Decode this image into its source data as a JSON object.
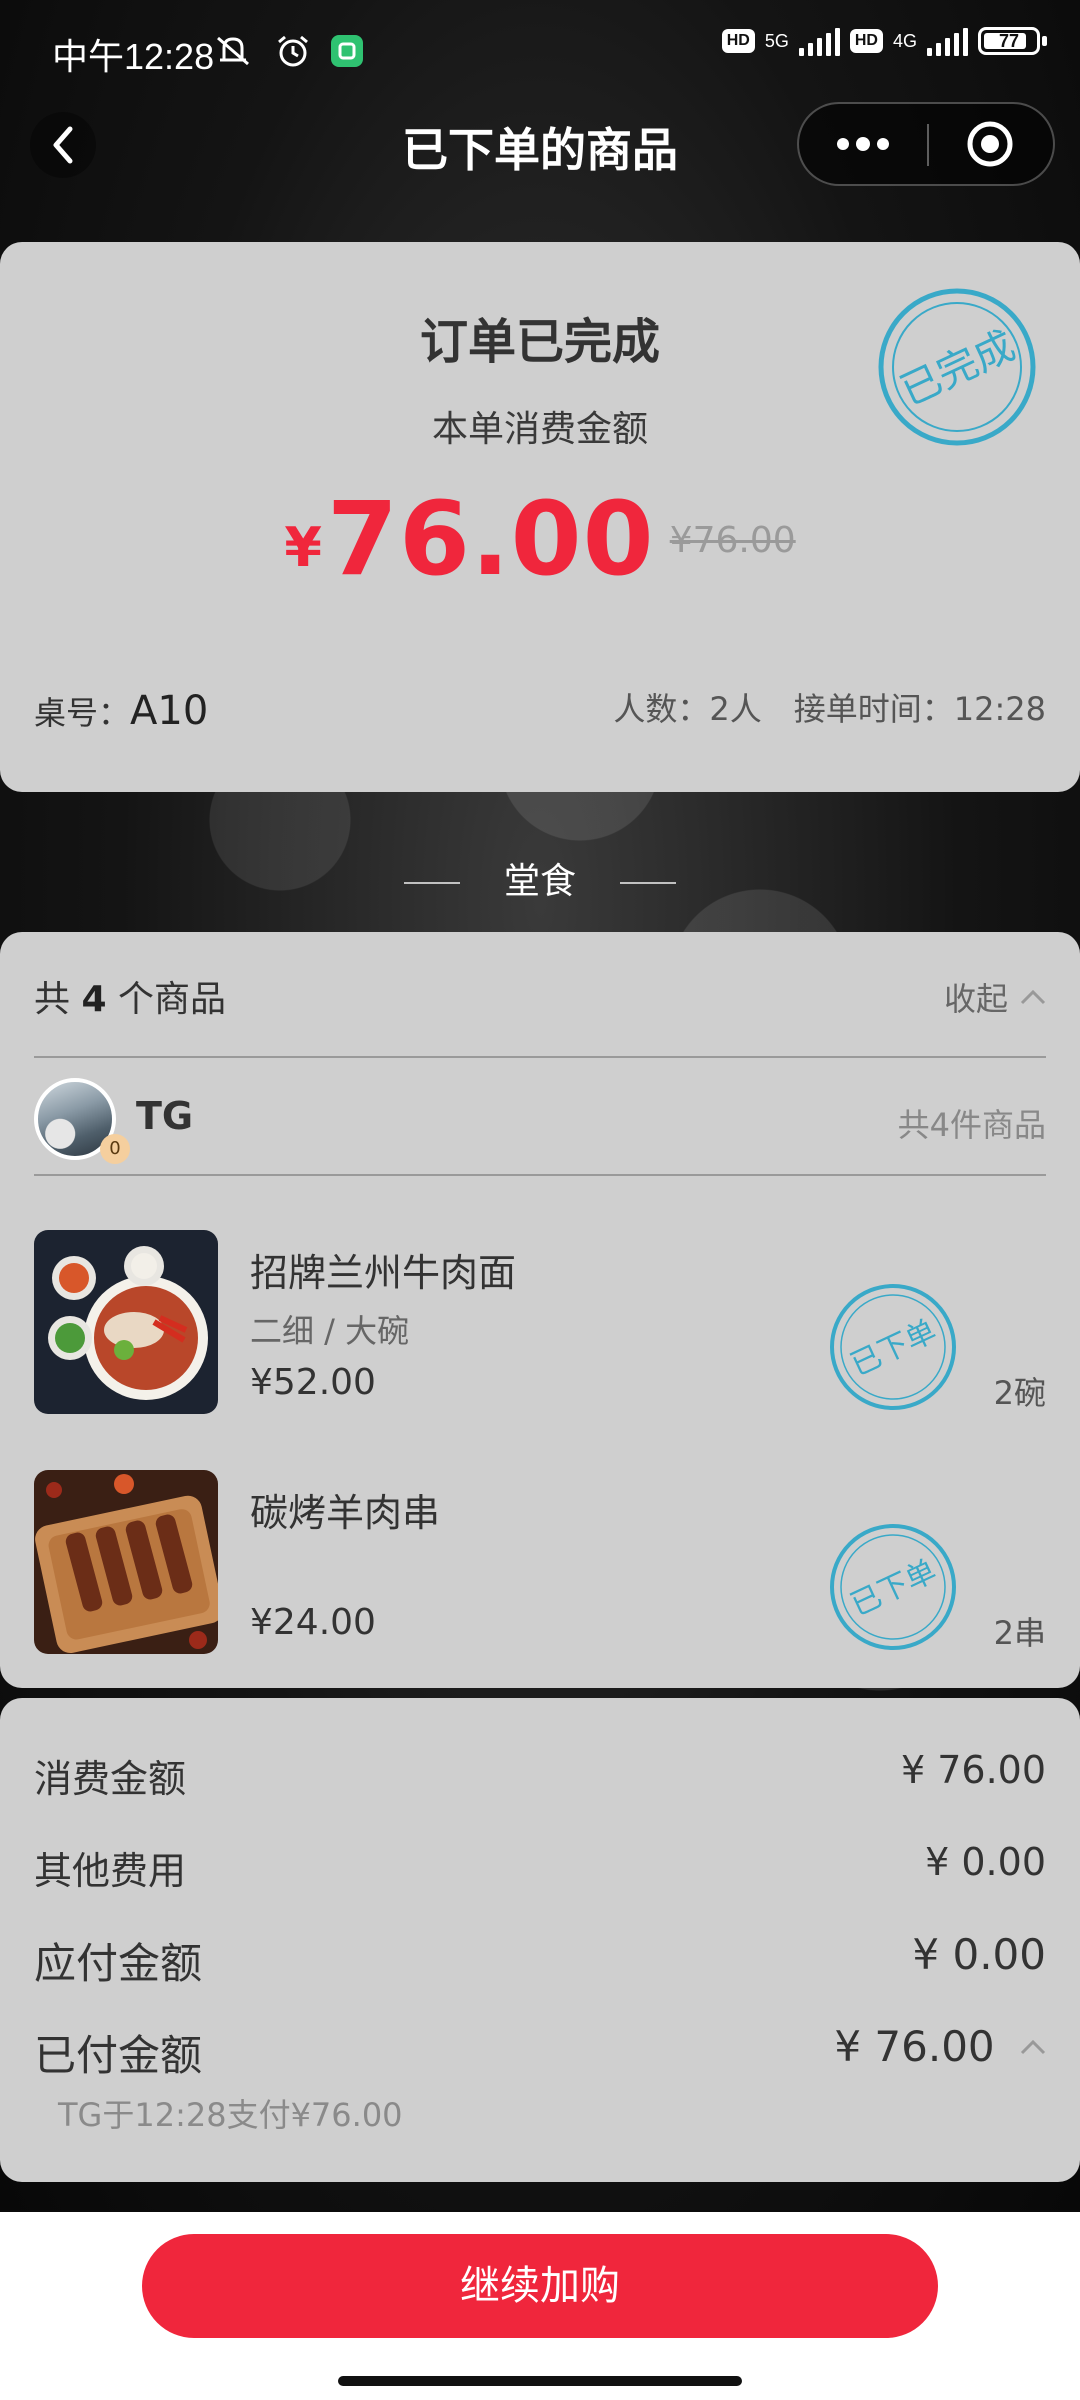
{
  "status_bar": {
    "time": "中午12:28",
    "hd1": "HD",
    "net1": "5G",
    "hd2": "HD",
    "net2": "4G",
    "battery": "77"
  },
  "header": {
    "title": "已下单的商品"
  },
  "order": {
    "status_title": "订单已完成",
    "amount_label": "本单消费金额",
    "currency": "¥",
    "amount": "76.00",
    "original_amount": "¥76.00",
    "stamp_text": "已完成",
    "table_label": "桌号：",
    "table_value": "A10",
    "people": "人数：2人",
    "order_time": "接单时间：12:28"
  },
  "section": {
    "label": "堂食"
  },
  "items_card": {
    "count_prefix": "共",
    "count": "4",
    "count_suffix": "个商品",
    "collapse_label": "收起",
    "user": {
      "name": "TG",
      "badge": "0",
      "total_text": "共4件商品"
    },
    "items": [
      {
        "name": "招牌兰州牛肉面",
        "spec": "二细 / 大碗",
        "price": "¥52.00",
        "qty": "2碗",
        "stamp": "已下单"
      },
      {
        "name": "碳烤羊肉串",
        "spec": "",
        "price": "¥24.00",
        "qty": "2串",
        "stamp": "已下单"
      }
    ]
  },
  "summary": {
    "rows": [
      {
        "label": "消费金额",
        "value": "¥ 76.00"
      },
      {
        "label": "其他费用",
        "value": "¥ 0.00"
      },
      {
        "label": "应付金额",
        "value": "¥ 0.00"
      },
      {
        "label": "已付金额",
        "value": "¥ 76.00"
      }
    ],
    "paid_note": "TG于12:28支付¥76.00"
  },
  "bottom": {
    "button_label": "继续加购"
  },
  "colors": {
    "accent": "#f0263c",
    "stamp": "#39a9c8",
    "card": "#cfcfcf"
  }
}
